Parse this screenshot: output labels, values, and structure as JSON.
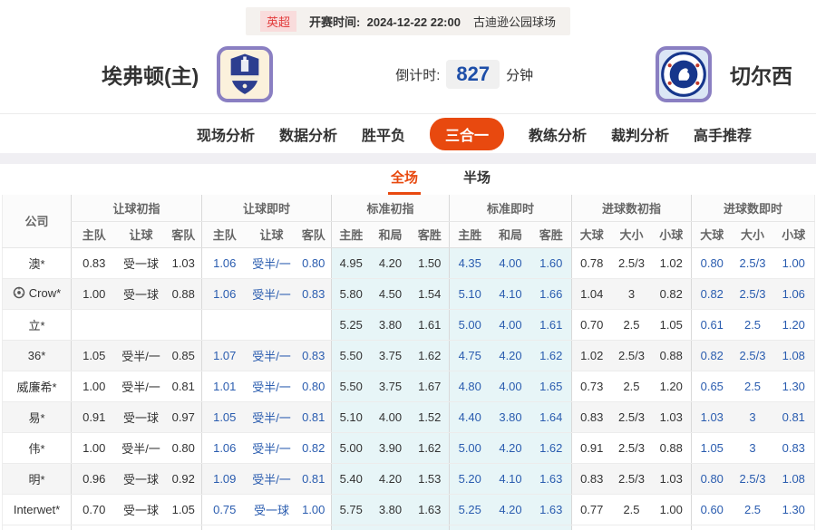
{
  "meta": {
    "league": "英超",
    "kickoff_label": "开赛时间:",
    "kickoff_time": "2024-12-22 22:00",
    "venue": "古迪逊公园球场"
  },
  "teams": {
    "home": {
      "name": "埃弗顿(主)"
    },
    "away": {
      "name": "切尔西"
    }
  },
  "countdown": {
    "label": "倒计时:",
    "value": "827",
    "unit": "分钟"
  },
  "nav": {
    "items": [
      {
        "label": "现场分析",
        "active": false
      },
      {
        "label": "数据分析",
        "active": false
      },
      {
        "label": "胜平负",
        "active": false
      },
      {
        "label": "三合一",
        "active": true
      },
      {
        "label": "教练分析",
        "active": false
      },
      {
        "label": "裁判分析",
        "active": false
      },
      {
        "label": "高手推荐",
        "active": false
      }
    ]
  },
  "subtabs": {
    "items": [
      {
        "label": "全场",
        "active": true
      },
      {
        "label": "半场",
        "active": false
      }
    ]
  },
  "table": {
    "company_header": "公司",
    "groups": [
      {
        "label": "让球初指",
        "cols": [
          "主队",
          "让球",
          "客队"
        ],
        "live": false,
        "highlight": false
      },
      {
        "label": "让球即时",
        "cols": [
          "主队",
          "让球",
          "客队"
        ],
        "live": true,
        "highlight": false
      },
      {
        "label": "标准初指",
        "cols": [
          "主胜",
          "和局",
          "客胜"
        ],
        "live": false,
        "highlight": true
      },
      {
        "label": "标准即时",
        "cols": [
          "主胜",
          "和局",
          "客胜"
        ],
        "live": true,
        "highlight": true
      },
      {
        "label": "进球数初指",
        "cols": [
          "大球",
          "大小",
          "小球"
        ],
        "live": false,
        "highlight": false
      },
      {
        "label": "进球数即时",
        "cols": [
          "大球",
          "大小",
          "小球"
        ],
        "live": true,
        "highlight": false
      }
    ],
    "rows": [
      {
        "company": "澳*",
        "icon": false,
        "cells": [
          "0.83",
          "受一球",
          "1.03",
          "1.06",
          "受半/一",
          "0.80",
          "4.95",
          "4.20",
          "1.50",
          "4.35",
          "4.00",
          "1.60",
          "0.78",
          "2.5/3",
          "1.02",
          "0.80",
          "2.5/3",
          "1.00"
        ]
      },
      {
        "company": "Crow*",
        "icon": true,
        "cells": [
          "1.00",
          "受一球",
          "0.88",
          "1.06",
          "受半/一",
          "0.83",
          "5.80",
          "4.50",
          "1.54",
          "5.10",
          "4.10",
          "1.66",
          "1.04",
          "3",
          "0.82",
          "0.82",
          "2.5/3",
          "1.06"
        ]
      },
      {
        "company": "立*",
        "icon": false,
        "cells": [
          "",
          "",
          "",
          "",
          "",
          "",
          "5.25",
          "3.80",
          "1.61",
          "5.00",
          "4.00",
          "1.61",
          "0.70",
          "2.5",
          "1.05",
          "0.61",
          "2.5",
          "1.20"
        ]
      },
      {
        "company": "36*",
        "icon": false,
        "cells": [
          "1.05",
          "受半/一",
          "0.85",
          "1.07",
          "受半/一",
          "0.83",
          "5.50",
          "3.75",
          "1.62",
          "4.75",
          "4.20",
          "1.62",
          "1.02",
          "2.5/3",
          "0.88",
          "0.82",
          "2.5/3",
          "1.08"
        ]
      },
      {
        "company": "威廉希*",
        "icon": false,
        "cells": [
          "1.00",
          "受半/一",
          "0.81",
          "1.01",
          "受半/一",
          "0.80",
          "5.50",
          "3.75",
          "1.67",
          "4.80",
          "4.00",
          "1.65",
          "0.73",
          "2.5",
          "1.20",
          "0.65",
          "2.5",
          "1.30"
        ]
      },
      {
        "company": "易*",
        "icon": false,
        "cells": [
          "0.91",
          "受一球",
          "0.97",
          "1.05",
          "受半/一",
          "0.81",
          "5.10",
          "4.00",
          "1.52",
          "4.40",
          "3.80",
          "1.64",
          "0.83",
          "2.5/3",
          "1.03",
          "1.03",
          "3",
          "0.81"
        ]
      },
      {
        "company": "伟*",
        "icon": false,
        "cells": [
          "1.00",
          "受半/一",
          "0.80",
          "1.06",
          "受半/一",
          "0.82",
          "5.00",
          "3.90",
          "1.62",
          "5.00",
          "4.20",
          "1.62",
          "0.91",
          "2.5/3",
          "0.88",
          "1.05",
          "3",
          "0.83"
        ]
      },
      {
        "company": "明*",
        "icon": false,
        "cells": [
          "0.96",
          "受一球",
          "0.92",
          "1.09",
          "受半/一",
          "0.81",
          "5.40",
          "4.20",
          "1.53",
          "5.20",
          "4.10",
          "1.63",
          "0.83",
          "2.5/3",
          "1.03",
          "0.80",
          "2.5/3",
          "1.08"
        ]
      },
      {
        "company": "Interwet*",
        "icon": false,
        "cells": [
          "0.70",
          "受一球",
          "1.05",
          "0.75",
          "受一球",
          "1.00",
          "5.75",
          "3.80",
          "1.63",
          "5.25",
          "4.20",
          "1.63",
          "0.77",
          "2.5",
          "1.00",
          "0.60",
          "2.5",
          "1.30"
        ]
      }
    ]
  },
  "colors": {
    "accent_orange": "#e8490f",
    "live_blue": "#2a5caf",
    "countdown_blue": "#1d4ea8",
    "highlight_cyan": "#e7f5f7",
    "league_red": "#e23c3c"
  }
}
